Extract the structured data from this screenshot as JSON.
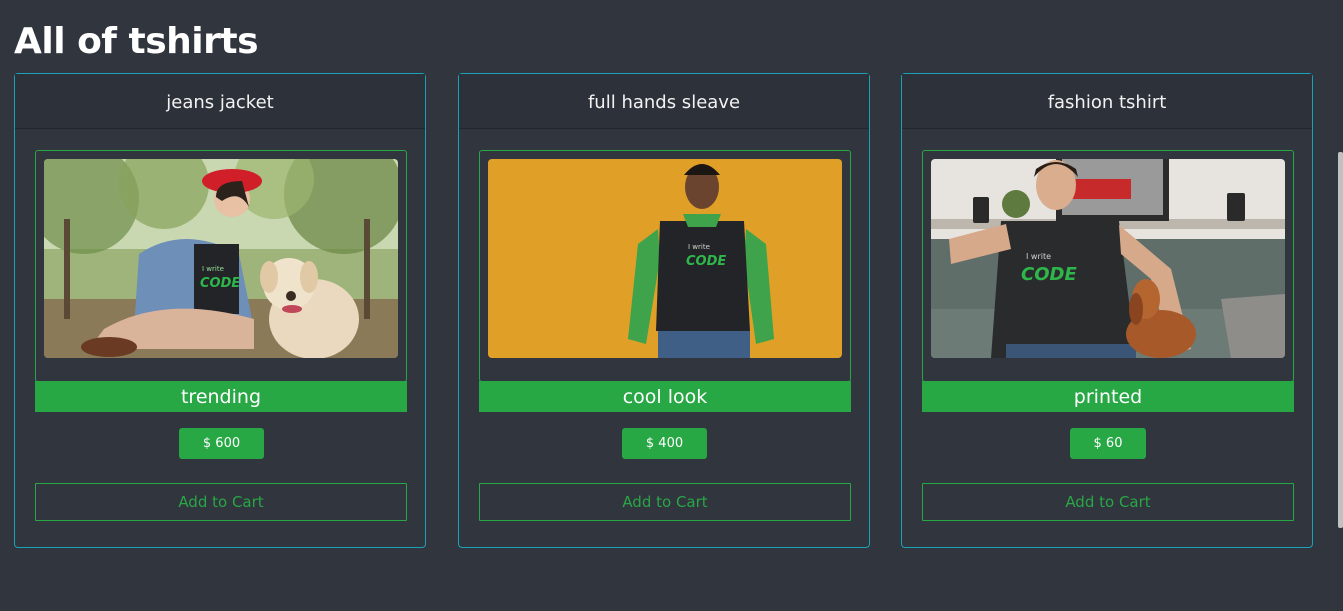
{
  "page": {
    "title": "All of tshirts"
  },
  "products": [
    {
      "name": "jeans jacket",
      "tag": "trending",
      "price": "$ 600",
      "cart_label": "Add to Cart",
      "image_icon": "woman-with-dog-photo",
      "shirt_text_small": "I write",
      "shirt_text_big": "CODE"
    },
    {
      "name": "full hands sleave",
      "tag": "cool look",
      "price": "$ 400",
      "cart_label": "Add to Cart",
      "image_icon": "man-yellow-wall-photo",
      "shirt_text_small": "I write",
      "shirt_text_big": "CODE"
    },
    {
      "name": "fashion tshirt",
      "tag": "printed",
      "price": "$ 60",
      "cart_label": "Add to Cart",
      "image_icon": "man-on-sofa-with-dog-photo",
      "shirt_text_small": "I write",
      "shirt_text_big": "CODE"
    }
  ],
  "colors": {
    "background": "#31353e",
    "accent_green": "#28a745",
    "card_border": "#17a2b8"
  }
}
